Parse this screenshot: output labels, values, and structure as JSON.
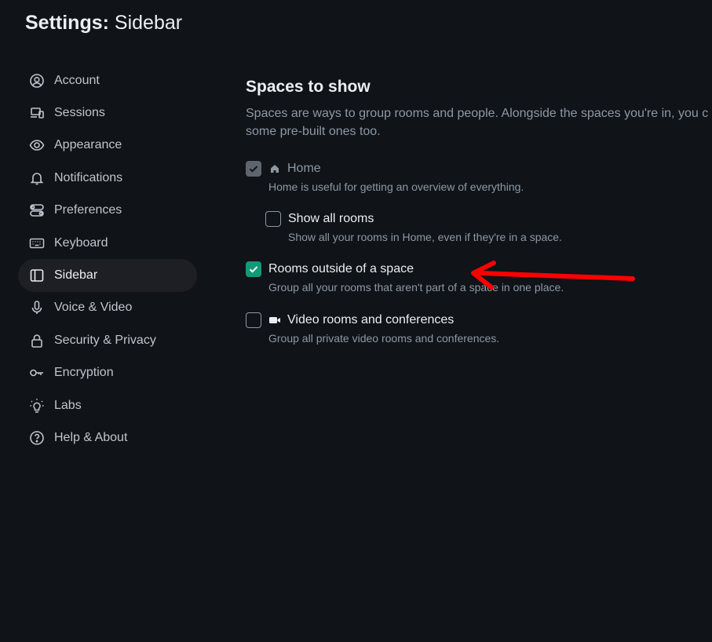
{
  "header": {
    "prefix": "Settings:",
    "section": "Sidebar"
  },
  "sidebar": {
    "items": [
      {
        "label": "Account",
        "icon": "user-circle-icon"
      },
      {
        "label": "Sessions",
        "icon": "devices-icon"
      },
      {
        "label": "Appearance",
        "icon": "eye-icon"
      },
      {
        "label": "Notifications",
        "icon": "bell-icon"
      },
      {
        "label": "Preferences",
        "icon": "toggles-icon"
      },
      {
        "label": "Keyboard",
        "icon": "keyboard-icon"
      },
      {
        "label": "Sidebar",
        "icon": "sidebar-icon",
        "active": true
      },
      {
        "label": "Voice & Video",
        "icon": "microphone-icon"
      },
      {
        "label": "Security & Privacy",
        "icon": "lock-icon"
      },
      {
        "label": "Encryption",
        "icon": "key-icon"
      },
      {
        "label": "Labs",
        "icon": "lightbulb-icon"
      },
      {
        "label": "Help & About",
        "icon": "help-circle-icon"
      }
    ]
  },
  "main": {
    "heading": "Spaces to show",
    "description": "Spaces are ways to group rooms and people. Alongside the spaces you're in, you c some pre-built ones too.",
    "description_line1": "Spaces are ways to group rooms and people. Alongside the spaces you're in, you c",
    "description_line2": "some pre-built ones too.",
    "options": {
      "home": {
        "label": "Home",
        "help": "Home is useful for getting an overview of everything.",
        "checked": true,
        "disabled": true,
        "icon": "home-icon"
      },
      "show_all_rooms": {
        "label": "Show all rooms",
        "help": "Show all your rooms in Home, even if they're in a space.",
        "checked": false
      },
      "rooms_outside": {
        "label": "Rooms outside of a space",
        "help": "Group all your rooms that aren't part of a space in one place.",
        "checked": true
      },
      "video_rooms": {
        "label": "Video rooms and conferences",
        "help": "Group all private video rooms and conferences.",
        "checked": false,
        "icon": "video-camera-icon"
      }
    }
  },
  "colors": {
    "background": "#101317",
    "accent": "#129a78",
    "annotation_arrow": "#ff0000"
  }
}
